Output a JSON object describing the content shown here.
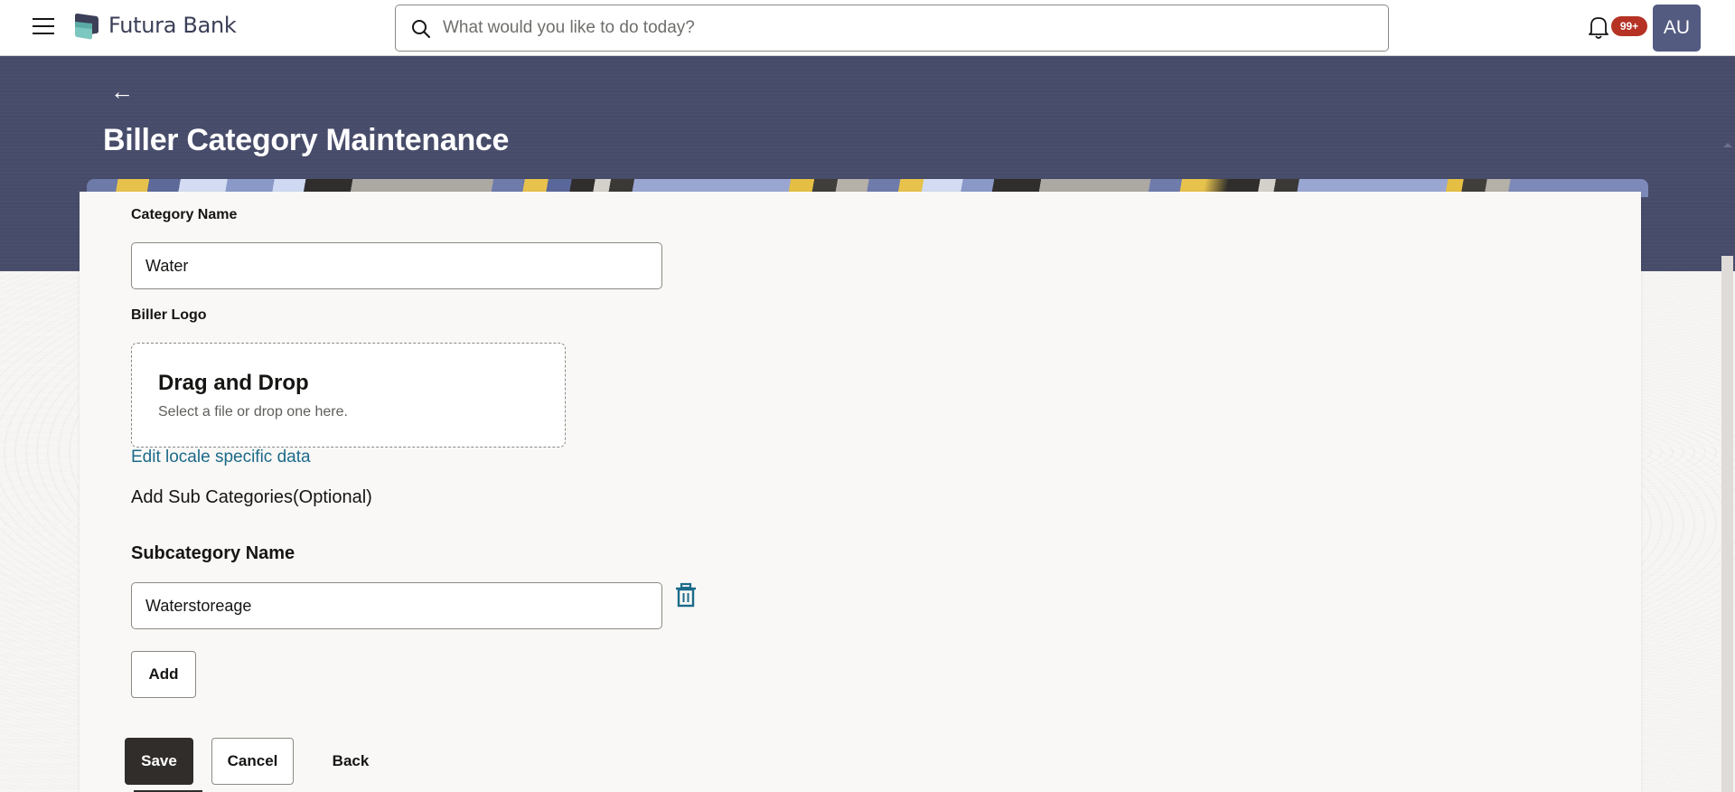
{
  "header": {
    "menu_icon": "hamburger-menu-icon",
    "brand_name": "Futura Bank",
    "search": {
      "placeholder": "What would you like to do today?",
      "value": ""
    },
    "notifications": {
      "icon": "bell-icon",
      "badge": "99+"
    },
    "avatar_initials": "AU"
  },
  "page": {
    "back_icon": "arrow-left-icon",
    "title": "Biller Category Maintenance"
  },
  "form": {
    "category_name": {
      "label": "Category Name",
      "value": "Water"
    },
    "biller_logo": {
      "label": "Biller Logo",
      "dropzone_title": "Drag and Drop",
      "dropzone_hint": "Select a file or drop one here."
    },
    "edit_locale_link": "Edit locale specific data",
    "subcategories_heading": "Add Sub Categories(Optional)",
    "subcategory": {
      "label": "Subcategory Name",
      "value": "Waterstoreage",
      "delete_icon": "trash-icon"
    },
    "add_button": "Add"
  },
  "actions": {
    "save": "Save",
    "cancel": "Cancel",
    "back": "Back"
  },
  "colors": {
    "brand_dark": "#474c6a",
    "primary_button": "#312d2a",
    "link": "#1c6a8a",
    "badge": "#b53224",
    "avatar": "#535b81"
  }
}
